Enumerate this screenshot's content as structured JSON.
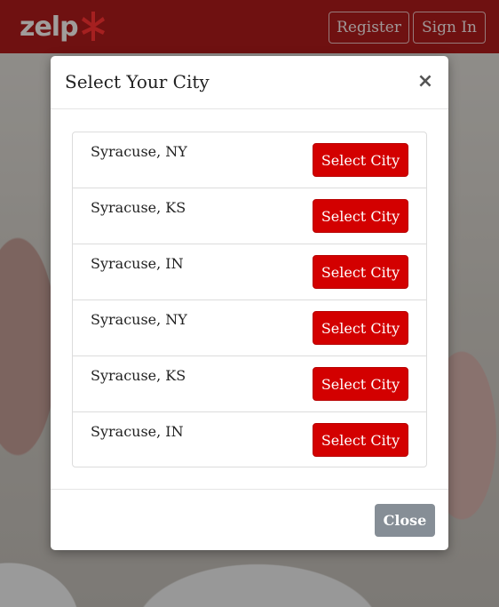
{
  "header": {
    "logo_text": "zelp",
    "register_label": "Register",
    "signin_label": "Sign In"
  },
  "modal": {
    "title": "Select Your City",
    "close_icon": "×",
    "cities": [
      {
        "name": "Syracuse, NY",
        "button": "Select City"
      },
      {
        "name": "Syracuse, KS",
        "button": "Select City"
      },
      {
        "name": "Syracuse, IN",
        "button": "Select City"
      },
      {
        "name": "Syracuse, NY",
        "button": "Select City"
      },
      {
        "name": "Syracuse, KS",
        "button": "Select City"
      },
      {
        "name": "Syracuse, IN",
        "button": "Select City"
      }
    ],
    "close_label": "Close"
  },
  "colors": {
    "brand_red": "#a30000",
    "button_red": "#d30000",
    "close_gray": "#868e96"
  },
  "icons": {
    "logo": "zelp-burst-icon",
    "close": "close-icon"
  }
}
